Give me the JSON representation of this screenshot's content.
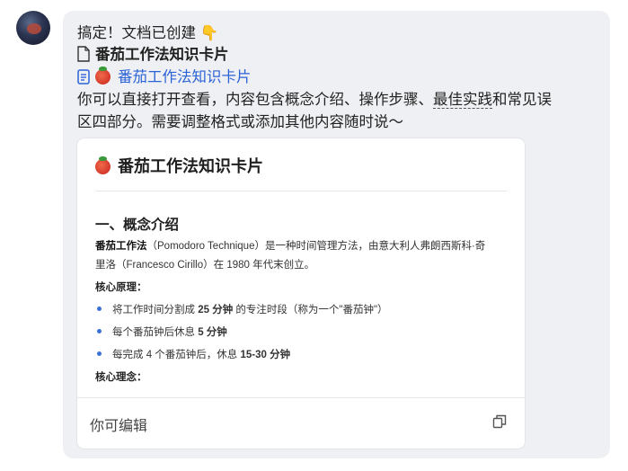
{
  "message": {
    "line1": "搞定！文档已创建 👇",
    "doc_title": "番茄工作法知识卡片",
    "link_text": "番茄工作法知识卡片",
    "desc_part1": "你可以直接打开查看，内容包含概念介绍、操作步骤、",
    "desc_underlined": "最佳实践",
    "desc_part2": "和常见误",
    "desc_line2": "区四部分。需要调整格式或添加其他内容随时说～"
  },
  "card": {
    "title": "番茄工作法知识卡片",
    "section1_heading": "一、概念介绍",
    "para_bold": "番茄工作法",
    "para_text1": "（Pomodoro Technique）是一种时间管理方法，由意大利人弗朗西斯科·奇",
    "para_text2": "里洛（Francesco Cirillo）在 1980 年代末创立。",
    "principle_label": "核心原理：",
    "bullets": [
      {
        "pre": "将工作时间分割成 ",
        "bold": "25 分钟",
        "post": " 的专注时段（称为一个\"番茄钟\"）"
      },
      {
        "pre": "每个番茄钟后休息 ",
        "bold": "5 分钟",
        "post": ""
      },
      {
        "pre": "每完成 4 个番茄钟后，休息 ",
        "bold": "15-30 分钟",
        "post": ""
      }
    ],
    "concept_label": "核心理念：",
    "footer_text": "你可编辑"
  },
  "icons": {
    "doc_icon": "document-icon",
    "link_icon": "doc-link-icon",
    "tomato": "tomato-emoji",
    "copy": "copy-icon"
  },
  "colors": {
    "link": "#2b62d6",
    "bubble": "#eef0f3",
    "bullet": "#3a70d8"
  }
}
